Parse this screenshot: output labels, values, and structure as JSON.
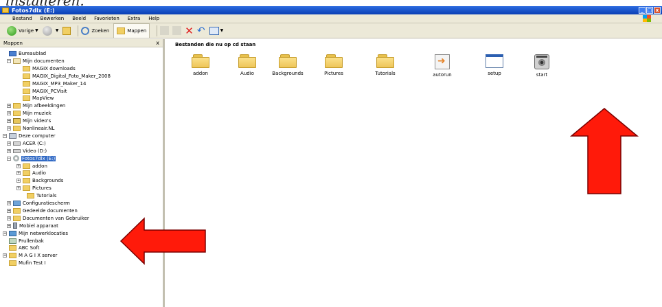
{
  "caption": "installeren.",
  "window": {
    "title": "Fotos7dlx (E:)",
    "controls": [
      "_",
      "□",
      "x"
    ]
  },
  "menu": {
    "items": [
      "Bestand",
      "Bewerken",
      "Beeld",
      "Favorieten",
      "Extra",
      "Help"
    ]
  },
  "toolbar": {
    "back_label": "Vorige",
    "search_label": "Zoeken",
    "folders_label": "Mappen"
  },
  "left_panel": {
    "header": "Mappen",
    "close": "x",
    "tree": [
      {
        "label": "Bureaublad",
        "icon": "desktop-icon",
        "expander": ""
      },
      {
        "label": "Mijn documenten",
        "icon": "my-documents-icon",
        "expander": "−"
      },
      {
        "label": "MAGIX downloads",
        "icon": "folder-icon",
        "expander": ""
      },
      {
        "label": "MAGIX_Digital_Foto_Maker_2008",
        "icon": "folder-icon",
        "expander": ""
      },
      {
        "label": "MAGIX_MP3_Maker_14",
        "icon": "folder-icon",
        "expander": ""
      },
      {
        "label": "MAGIX_PCVisit",
        "icon": "folder-icon",
        "expander": ""
      },
      {
        "label": "MapView",
        "icon": "folder-icon",
        "expander": ""
      },
      {
        "label": "Mijn afbeeldingen",
        "icon": "folder-icon",
        "expander": "+"
      },
      {
        "label": "Mijn muziek",
        "icon": "music-folder-icon",
        "expander": "+"
      },
      {
        "label": "Mijn video's",
        "icon": "video-folder-icon",
        "expander": "+"
      },
      {
        "label": "Nonlineair.NL",
        "icon": "folder-icon",
        "expander": "+"
      },
      {
        "label": "Deze computer",
        "icon": "computer-icon",
        "expander": "−"
      },
      {
        "label": "ACER (C:)",
        "icon": "drive-icon",
        "expander": "+"
      },
      {
        "label": "Video (D:)",
        "icon": "drive-icon",
        "expander": "+"
      },
      {
        "label": "Fotos7dlx (E:)",
        "icon": "cd-drive-icon",
        "expander": "−",
        "selected": true
      },
      {
        "label": "addon",
        "icon": "folder-icon",
        "expander": "+"
      },
      {
        "label": "Audio",
        "icon": "folder-icon",
        "expander": "+"
      },
      {
        "label": "Backgrounds",
        "icon": "folder-icon",
        "expander": "+"
      },
      {
        "label": "Pictures",
        "icon": "folder-icon",
        "expander": "+"
      },
      {
        "label": "Tutorials",
        "icon": "folder-icon",
        "expander": ""
      },
      {
        "label": "Configuratiescherm",
        "icon": "control-panel-icon",
        "expander": "+"
      },
      {
        "label": "Gedeelde documenten",
        "icon": "folder-icon",
        "expander": "+"
      },
      {
        "label": "Documenten van Gebruiker",
        "icon": "folder-icon",
        "expander": "+"
      },
      {
        "label": "Mobiel apparaat",
        "icon": "mobile-device-icon",
        "expander": "+"
      },
      {
        "label": "Mijn netwerklocaties",
        "icon": "network-icon",
        "expander": "+"
      },
      {
        "label": "Prullenbak",
        "icon": "recycle-bin-icon",
        "expander": ""
      },
      {
        "label": "ABC Soft",
        "icon": "folder-icon",
        "expander": ""
      },
      {
        "label": "M A G I X server",
        "icon": "folder-icon",
        "expander": "+"
      },
      {
        "label": "Mufin Test I",
        "icon": "folder-icon",
        "expander": ""
      }
    ]
  },
  "main": {
    "header": "Bestanden die nu op cd staan",
    "files": [
      {
        "label": "addon",
        "icon": "folder-icon"
      },
      {
        "label": "Audio",
        "icon": "folder-icon"
      },
      {
        "label": "Backgrounds",
        "icon": "folder-icon"
      },
      {
        "label": "Pictures",
        "icon": "folder-icon"
      },
      {
        "label": "Tutorials",
        "icon": "folder-icon"
      },
      {
        "label": "autorun",
        "icon": "autorun-icon"
      },
      {
        "label": "setup",
        "icon": "setup-icon"
      },
      {
        "label": "start",
        "icon": "start-icon"
      }
    ]
  },
  "annotations": {
    "arrow_color": "#ff1a0a",
    "arrow_outline": "#7a0000"
  }
}
